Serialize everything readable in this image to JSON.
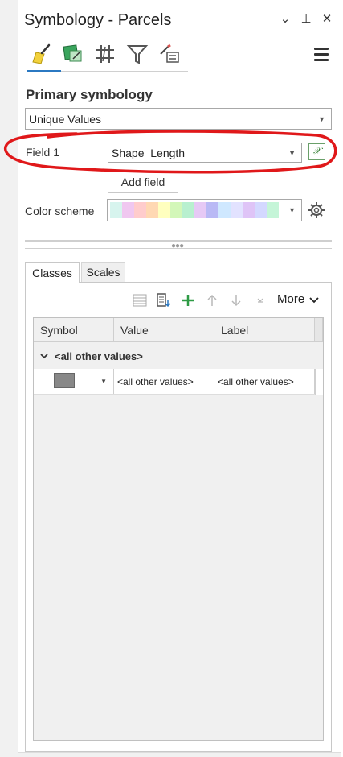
{
  "panel": {
    "title": "Symbology - Parcels",
    "controls": {
      "options": "⌄",
      "pin": "⊥",
      "close": "✕"
    }
  },
  "primary": {
    "heading": "Primary symbology",
    "method": "Unique Values",
    "field_label": "Field 1",
    "field_value": "Shape_Length",
    "add_field": "Add field",
    "color_scheme_label": "Color scheme",
    "color_scheme_colors": [
      "#d7f4ee",
      "#f0c7f0",
      "#ffcccc",
      "#ffd8b3",
      "#ffffbf",
      "#d3f7b9",
      "#b8f0cf",
      "#e6c9f5",
      "#b9b9f5",
      "#cfe8ff",
      "#e2e2ff",
      "#dfc4f7",
      "#d4d8ff",
      "#c5f5d8"
    ]
  },
  "classes": {
    "tab_classes": "Classes",
    "tab_scales": "Scales",
    "more_label": "More",
    "columns": [
      "Symbol",
      "Value",
      "Label"
    ],
    "group_label": "<all other values>",
    "row": {
      "value": "<all other values>",
      "label": "<all other values>",
      "symbol_color": "#888888"
    }
  },
  "colors": {
    "accent": "#2b79c2",
    "annotation_red": "#e0181a"
  }
}
